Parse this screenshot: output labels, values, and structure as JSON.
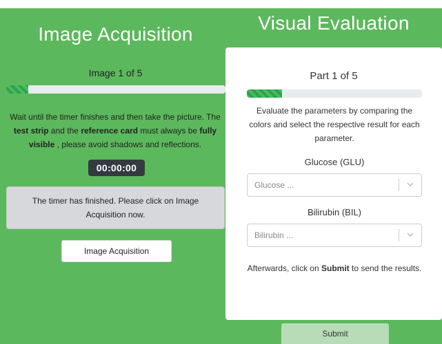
{
  "left": {
    "title": "Image Acquisition",
    "counter": "Image 1 of 5",
    "progress": 0.1,
    "instructions": {
      "p1": "Wait until the timer finishes and then take the picture. The ",
      "b1": "test strip",
      "p2": " and the ",
      "b2": "reference card",
      "p3": " must always be ",
      "b3": "fully visible",
      "p4": " , please avoid shadows and reflections."
    },
    "timer": "00:00:00",
    "alert": "The timer has finished. Please click on Image Acquisition now.",
    "button_label": "Image Acquisition"
  },
  "right": {
    "title": "Visual Evaluation",
    "counter": "Part 1 of 5",
    "progress": 0.2,
    "instructions": "Evaluate the parameters by comparing the colors and select the respective result for each parameter.",
    "fields": [
      {
        "label": "Glucose (GLU)",
        "placeholder": "Glucose ..."
      },
      {
        "label": "Bilirubin (BIL)",
        "placeholder": "Bilirubin ..."
      }
    ],
    "after": {
      "p1": "Afterwards, click on ",
      "b1": "Submit",
      "p2": " to send the results."
    },
    "submit_label": "Submit"
  },
  "colors": {
    "background": "#5cb85c",
    "progress_bar": "#28a745",
    "timer_bg": "#343a40",
    "alert_bg": "#d6d8db",
    "submit_bg": "#b7dcb7"
  },
  "icons": {
    "select_chevron": "chevron-down-icon"
  }
}
